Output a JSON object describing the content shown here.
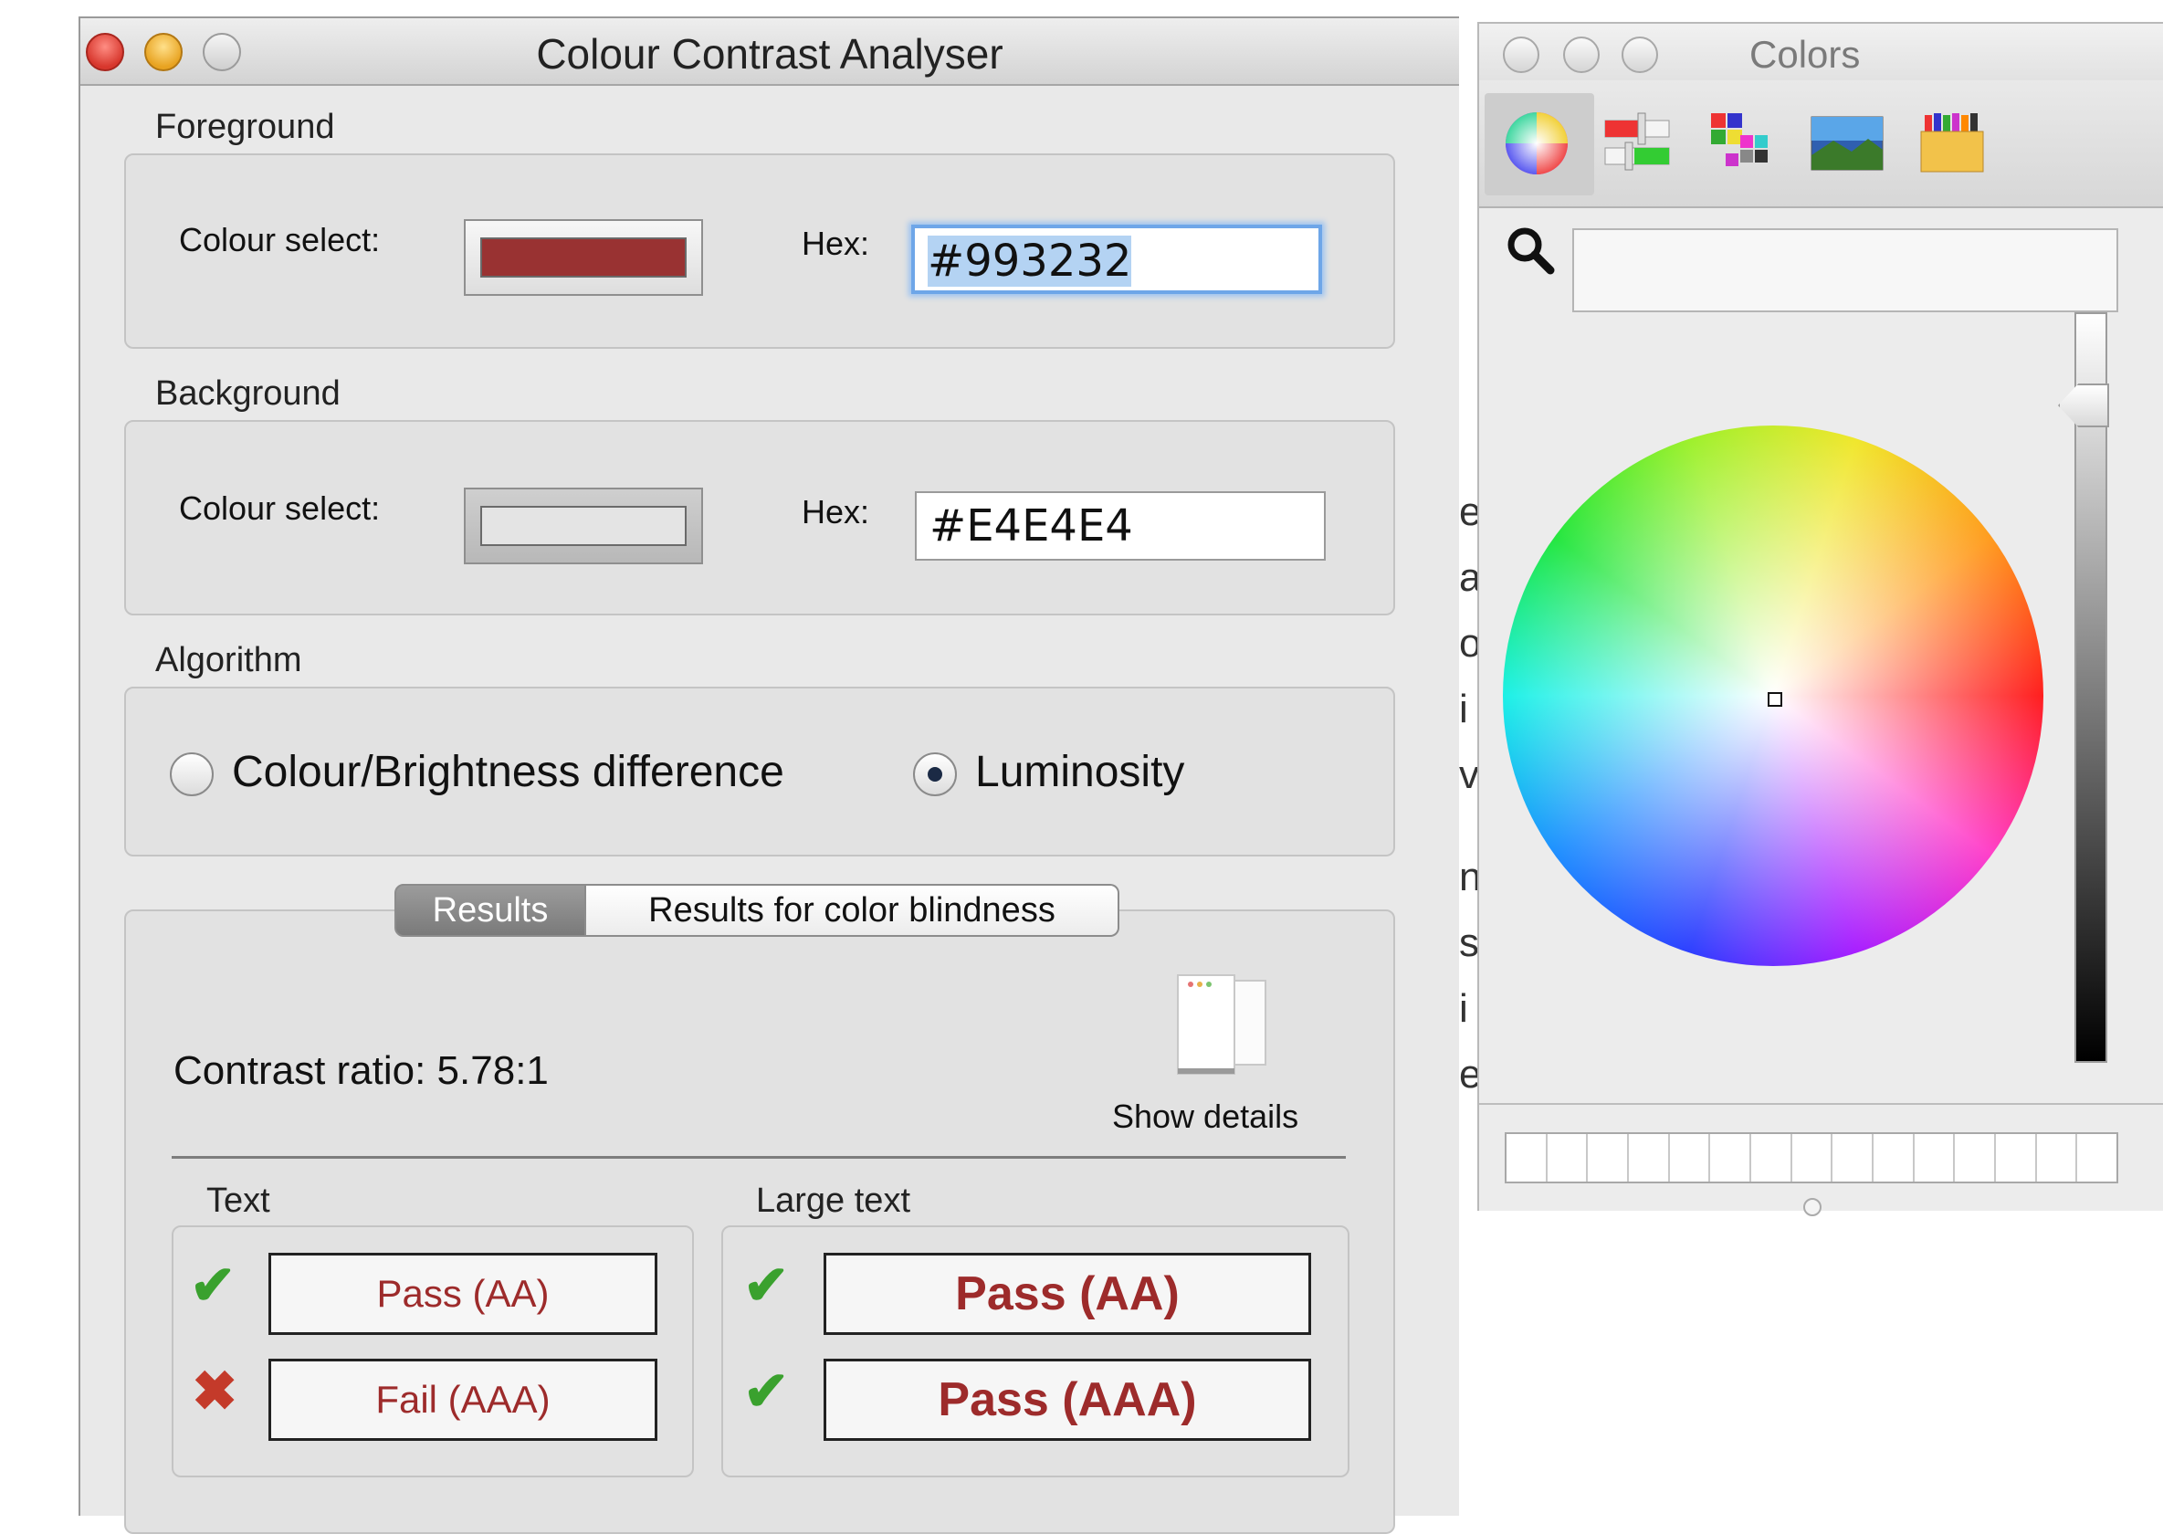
{
  "cca": {
    "title": "Colour Contrast Analyser",
    "foreground": {
      "label": "Foreground",
      "colour_select_label": "Colour select:",
      "hex_label": "Hex:",
      "hex_value": "#993232",
      "swatch_color": "#993232"
    },
    "background": {
      "label": "Background",
      "colour_select_label": "Colour select:",
      "hex_label": "Hex:",
      "hex_value": "#E4E4E4",
      "swatch_color": "#E4E4E4"
    },
    "algorithm": {
      "label": "Algorithm",
      "options": [
        "Colour/Brightness difference",
        "Luminosity"
      ],
      "selected": "Luminosity"
    },
    "tabs": [
      "Results",
      "Results for color blindness"
    ],
    "active_tab": "Results",
    "contrast_ratio_text": "Contrast ratio: 5.78:1",
    "show_details_label": "Show details",
    "text_group": {
      "label": "Text",
      "results": [
        {
          "status": "pass",
          "label": "Pass (AA)"
        },
        {
          "status": "fail",
          "label": "Fail (AAA)"
        }
      ]
    },
    "large_text_group": {
      "label": "Large text",
      "results": [
        {
          "status": "pass",
          "label": "Pass (AA)"
        },
        {
          "status": "pass",
          "label": "Pass (AAA)"
        }
      ]
    }
  },
  "colors_panel": {
    "title": "Colors",
    "toolbar_icons": [
      "color-wheel-icon",
      "sliders-icon",
      "palettes-icon",
      "image-palettes-icon",
      "crayons-icon"
    ],
    "search_placeholder": ""
  },
  "background_doc_letters": [
    "e",
    "a",
    "o",
    "i",
    "v",
    "n",
    "s",
    "i",
    "e"
  ],
  "colors_meta": {
    "pass_color": "#3aa12e",
    "fail_color": "#c43a2a",
    "result_text_color": "#9d2b2b"
  }
}
